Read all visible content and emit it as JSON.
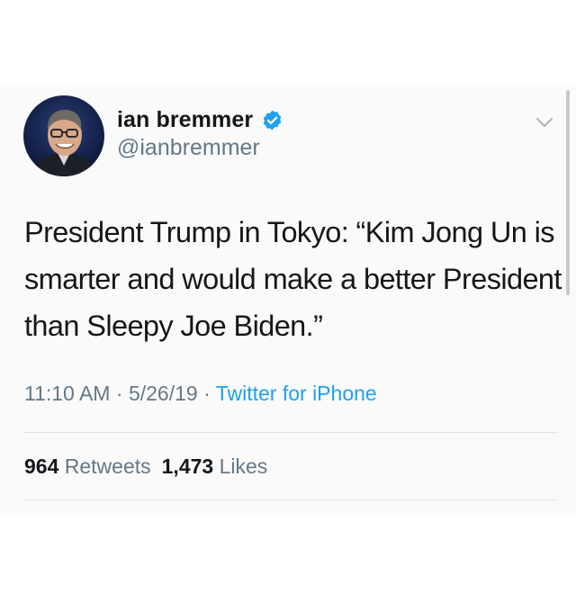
{
  "tweet": {
    "author": {
      "name": "ian bremmer",
      "handle": "@ianbremmer",
      "verified": true
    },
    "text": "President Trump in Tokyo: “Kim Jong Un is smarter and would make a better President than Sleepy Joe Biden.”",
    "meta": {
      "time": "11:10 AM",
      "separator": " · ",
      "date": "5/26/19",
      "source": "Twitter for iPhone"
    },
    "stats": {
      "retweets_count": "964",
      "retweets_label": "Retweets",
      "likes_count": "1,473",
      "likes_label": "Likes"
    }
  },
  "icons": {
    "verified": "verified-badge-icon",
    "menu": "chevron-down-icon"
  },
  "colors": {
    "accent": "#1da1f2",
    "text_primary": "#14171a",
    "text_secondary": "#657786",
    "divider": "#dfe3e6"
  }
}
